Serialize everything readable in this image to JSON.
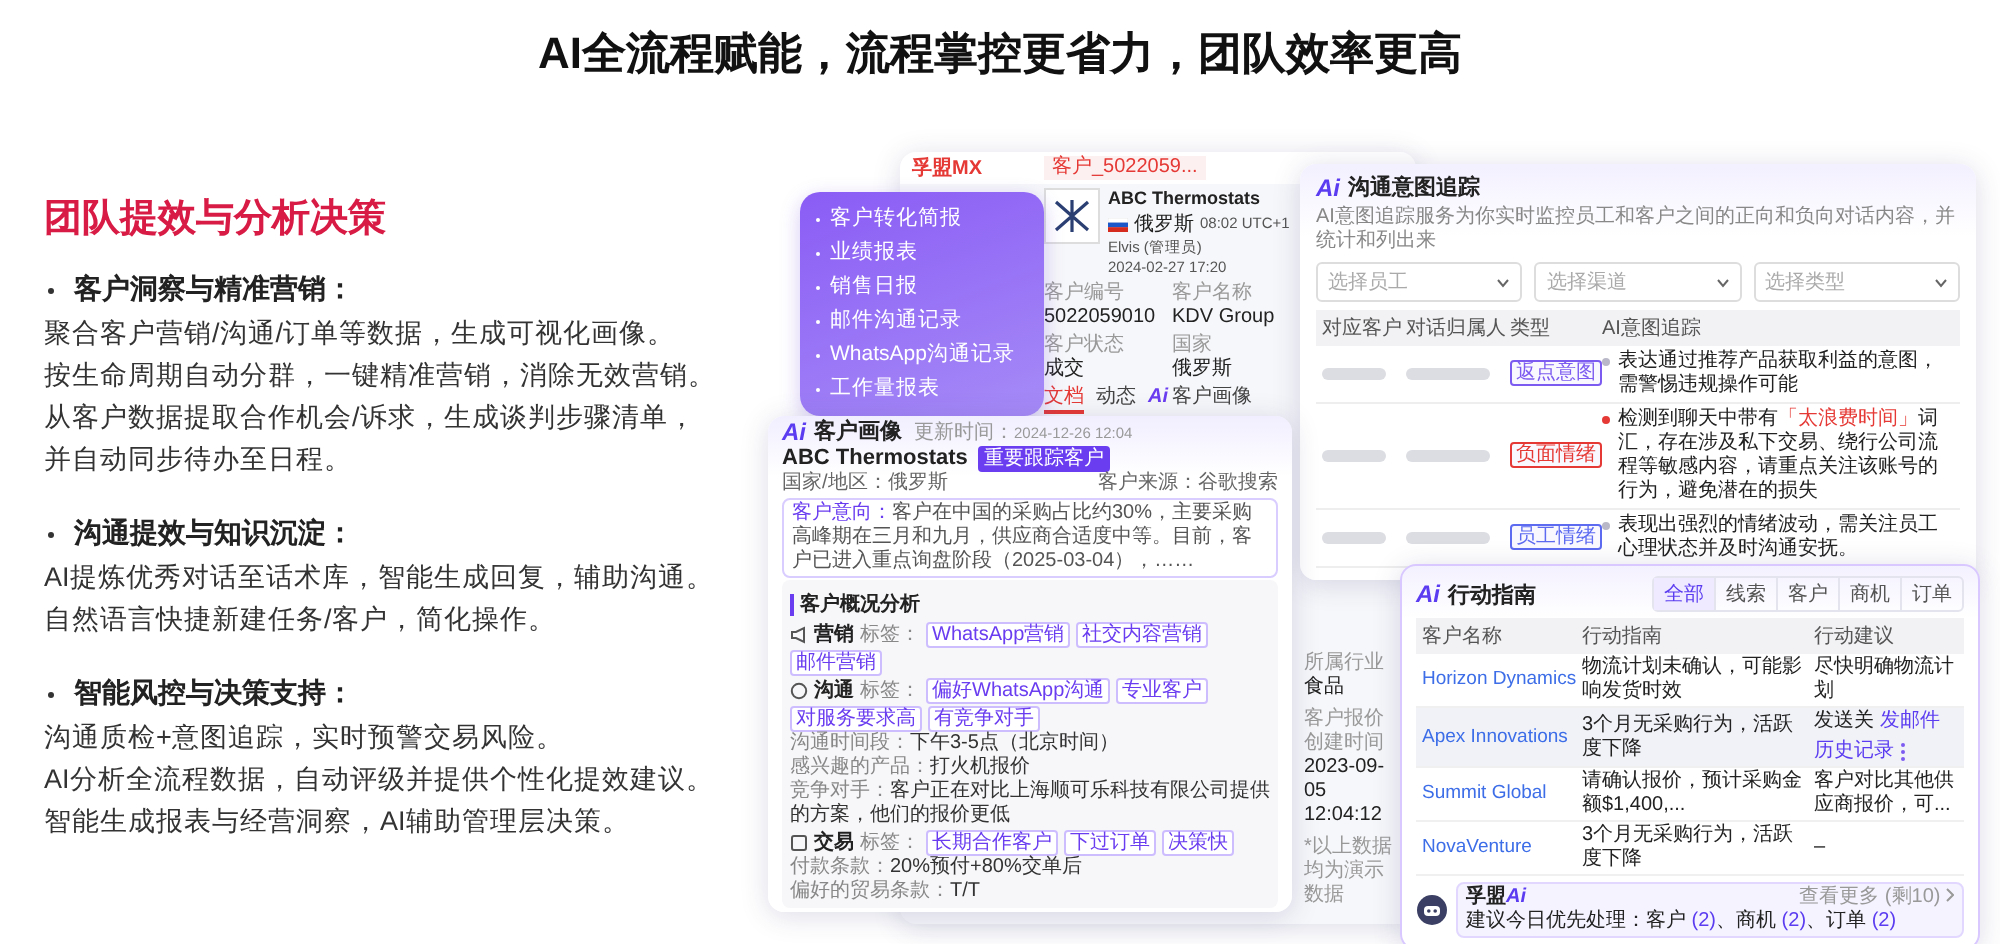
{
  "headline": "AI全流程赋能，流程掌控更省力，团队效率更高",
  "section": {
    "title": "团队提效与分析决策",
    "points": [
      {
        "title": "客户洞察与精准营销：",
        "lines": [
          "聚合客户营销/沟通/订单等数据，生成可视化画像。",
          "按生命周期自动分群，一键精准营销，消除无效营销。",
          "从客户数据提取合作机会/诉求，生成谈判步骤清单，",
          "并自动同步待办至日程。"
        ]
      },
      {
        "title": "沟通提效与知识沉淀：",
        "lines": [
          "AI提炼优秀对话至话术库，智能生成回复，辅助沟通。",
          "自然语言快捷新建任务/客户，简化操作。"
        ]
      },
      {
        "title": "智能风控与决策支持：",
        "lines": [
          "沟通质检+意图追踪，实时预警交易风险。",
          "AI分析全流程数据，自动评级并提供个性化提效建议。",
          "智能生成报表与经营洞察，AI辅助管理层决策。"
        ]
      }
    ]
  },
  "feature_menu": {
    "items": [
      "客户转化简报",
      "业绩报表",
      "销售日报",
      "邮件沟通记录",
      "WhatsApp沟通记录",
      "工作量报表"
    ]
  },
  "crm_window": {
    "brand": "孚盟MX",
    "tab": "客户_5022059...",
    "company": {
      "name": "ABC Thermostats",
      "country": "俄罗斯",
      "time": "08:02 UTC+1",
      "owner": "Elvis (管理员)",
      "date": "2024-02-27 17:20"
    },
    "fields": [
      {
        "label": "客户编号",
        "value": "5022059010"
      },
      {
        "label": "客户名称",
        "value": "KDV Group"
      },
      {
        "label": "客户状态",
        "value": "成交"
      },
      {
        "label": "国家",
        "value": "俄罗斯"
      }
    ],
    "tabs": [
      {
        "label": "文档",
        "kind": "plain",
        "selected": true
      },
      {
        "label": "动态",
        "kind": "plain",
        "selected": false
      },
      {
        "label": "客户画像",
        "kind": "ai",
        "badge": "Ai",
        "selected": false
      }
    ],
    "lower_fields": [
      {
        "label": "所属行业",
        "value": "食品"
      },
      {
        "label": "客户报价创建时间",
        "value": "2023-09-05 12:04:12"
      }
    ],
    "footnote": "*以上数据均为演示数据"
  },
  "intent_panel": {
    "logo": "Ai",
    "title": "沟通意图追踪",
    "subtitle": "AI意图追踪服务为你实时监控员工和客户之间的正向和负向对话内容，并统计和列出来",
    "filters": [
      "选择员工",
      "选择渠道",
      "选择类型"
    ],
    "columns": [
      "对应客户",
      "对话归属人",
      "类型",
      "AI意图追踪"
    ],
    "rows": [
      {
        "tag": "返点意图",
        "color": "#7c5cf0",
        "alert": false,
        "segments": [
          {
            "kind": "plain",
            "text": "表达通过推荐产品获取利益的意图，需警惕违规操作可能"
          }
        ]
      },
      {
        "tag": "负面情绪",
        "color": "#e53935",
        "alert": true,
        "segments": [
          {
            "kind": "plain",
            "text": "检测到聊天中带有"
          },
          {
            "kind": "alert",
            "text": "「太浪费时间」"
          },
          {
            "kind": "plain",
            "text": "词汇，存在涉及私下交易、绕行公司流程等敏感内容，请重点关注该账号的行为，避免潜在的损失"
          }
        ]
      },
      {
        "tag": "员工情绪",
        "color": "#5c6bf0",
        "alert": false,
        "segments": [
          {
            "kind": "plain",
            "text": "表现出强烈的情绪波动，需关注员工心理状态并及时沟通安抚。"
          }
        ]
      }
    ]
  },
  "profile_panel": {
    "logo": "Ai",
    "title": "客户画像",
    "updated_label": "更新时间：",
    "updated": "2024-12-26 12:04",
    "name": "ABC Thermostats",
    "tag": "重要跟踪客户",
    "country_label": "国家/地区：",
    "country": "俄罗斯",
    "source_label": "客户来源：",
    "source": "谷歌搜索",
    "intent_label": "客户意向：",
    "intent": "客户在中国的采购占比约30%，主要采购高峰期在三月和九月，供应商合适度中等。目前，客户已进入重点询盘阶段（2025-03-04），……",
    "analysis_title": "客户概况分析",
    "sections": [
      {
        "kind": "marketing",
        "title": "营销",
        "tag_label": "标签：",
        "tags": [
          "WhatsApp营销",
          "社交内容营销",
          "邮件营销"
        ]
      },
      {
        "kind": "communication",
        "title": "沟通",
        "tag_label": "标签：",
        "tags": [
          "偏好WhatsApp沟通",
          "专业客户",
          "对服务要求高",
          "有竞争对手"
        ],
        "details": [
          {
            "label": "沟通时间段：",
            "value": "下午3-5点（北京时间）"
          },
          {
            "label": "感兴趣的产品：",
            "value": "打火机报价"
          },
          {
            "label": "竞争对手：",
            "value": "客户正在对比上海顺可乐科技有限公司提供的方案，他们的报价更低"
          }
        ]
      },
      {
        "kind": "deal",
        "title": "交易",
        "tag_label": "标签：",
        "tags": [
          "长期合作客户",
          "下过订单",
          "决策快"
        ],
        "details": [
          {
            "label": "付款条款：",
            "value": "20%预付+80%交单后"
          },
          {
            "label": "偏好的贸易条款：",
            "value": "T/T"
          }
        ]
      }
    ]
  },
  "action_panel": {
    "logo": "Ai",
    "title": "行动指南",
    "tabs": [
      {
        "label": "全部",
        "selected": true
      },
      {
        "label": "线索",
        "selected": false
      },
      {
        "label": "客户",
        "selected": false
      },
      {
        "label": "商机",
        "selected": false
      },
      {
        "label": "订单",
        "selected": false
      }
    ],
    "columns": [
      "客户名称",
      "行动指南",
      "行动建议"
    ],
    "rows": [
      {
        "customer": "Horizon Dynamics",
        "guide": "物流计划未确认，可能影响发货时效",
        "suggestion": "尽快明确物流计划",
        "highlighted": false
      },
      {
        "customer": "Apex Innovations",
        "guide": "3个月无采购行为，活跃度下降",
        "suggestion": "发送关",
        "highlighted": true,
        "actions": [
          "发邮件",
          "历史记录"
        ]
      },
      {
        "customer": "Summit Global",
        "guide": "请确认报价，预计采购金额$1,400,...",
        "suggestion": "客户对比其他供应商报价，可...",
        "highlighted": false
      },
      {
        "customer": "NovaVenture",
        "guide": "3个月无采购行为，活跃度下降",
        "suggestion": "–",
        "highlighted": false
      }
    ],
    "footer": {
      "brand": "孚盟",
      "logo": "Ai",
      "text": "建议今日优先处理：",
      "items": [
        {
          "label": "客户",
          "count": "(2)"
        },
        {
          "label": "、商机",
          "count": "(2)"
        },
        {
          "label": "、订单",
          "count": "(2)"
        }
      ],
      "more": "查看更多 (剩10)"
    }
  }
}
